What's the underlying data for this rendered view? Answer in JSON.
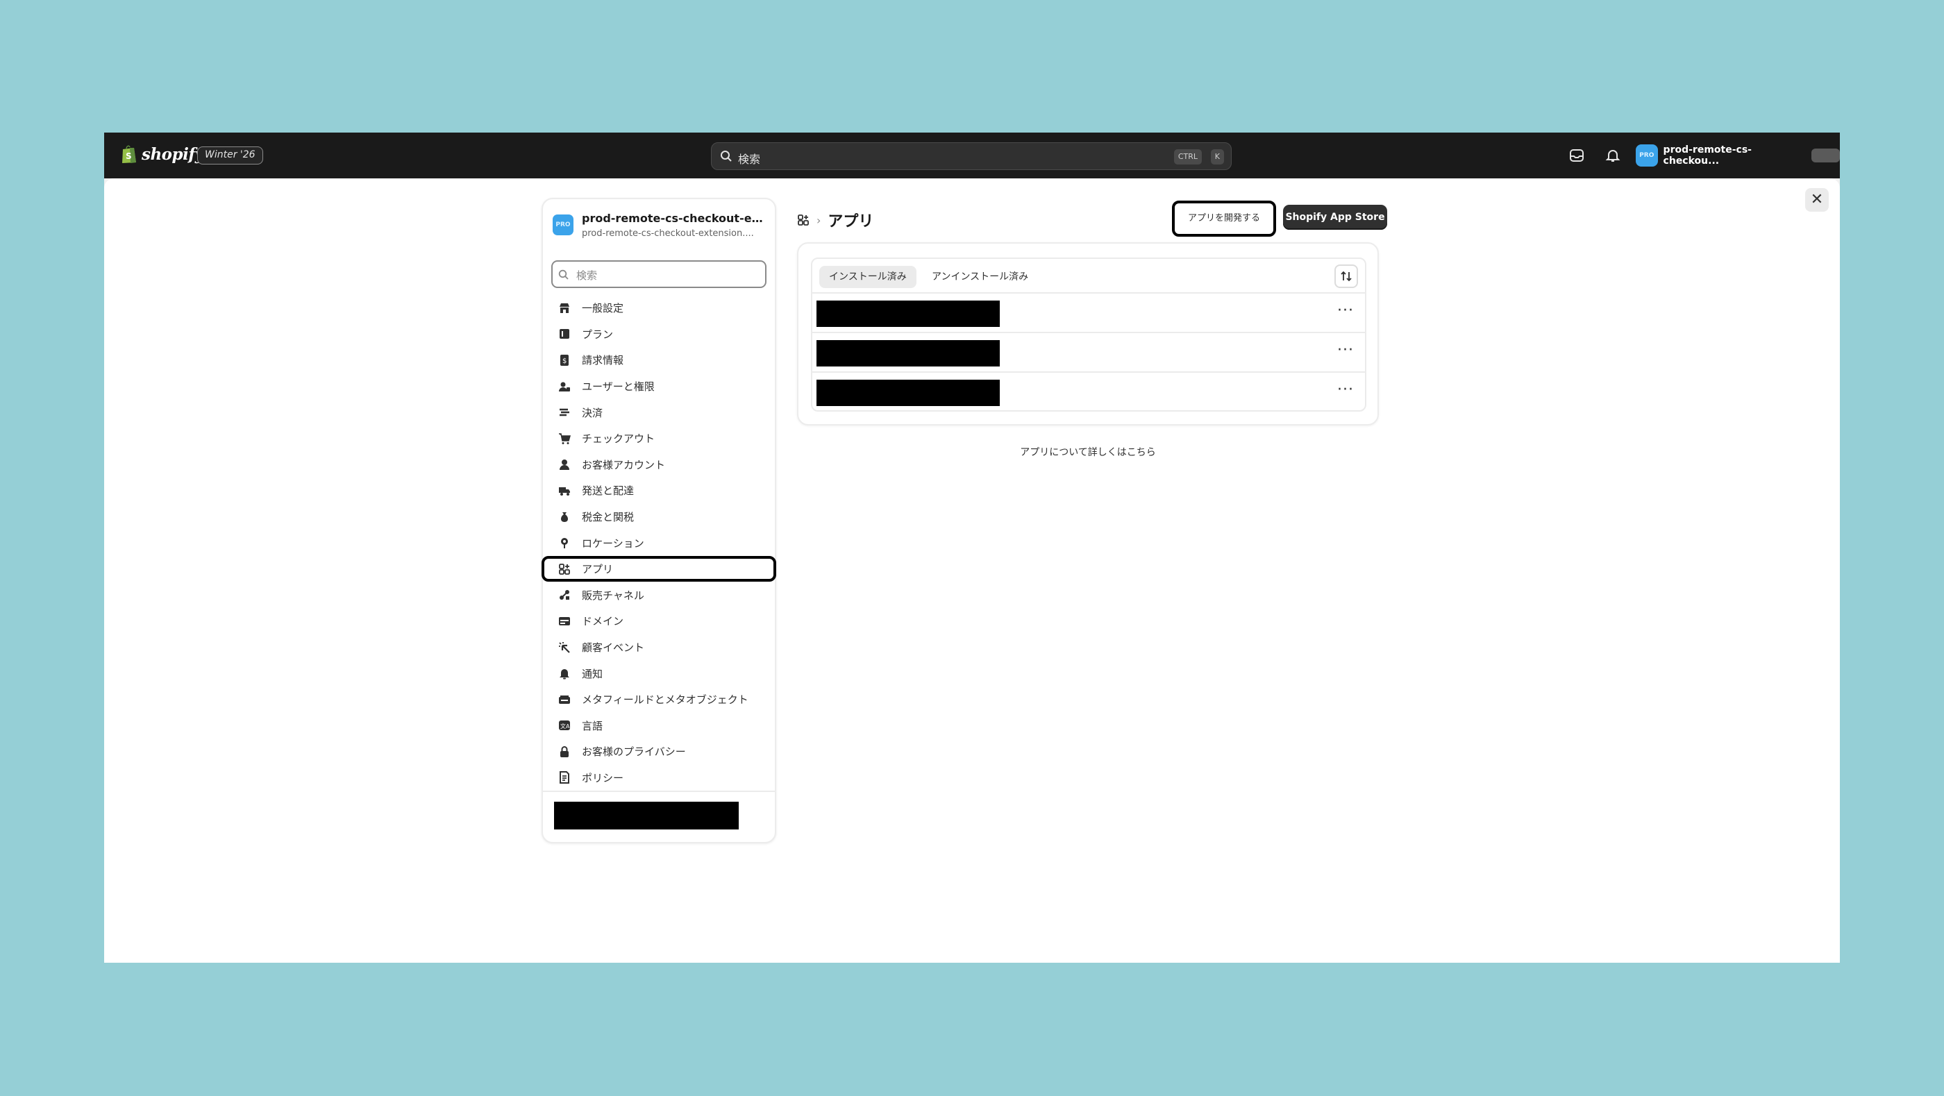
{
  "topbar": {
    "brand": "shopify",
    "edition": "Winter '26",
    "search_placeholder": "検索",
    "shortcut_ctrl": "CTRL",
    "shortcut_key": "K",
    "store_avatar": "PRO",
    "store_name": "prod-remote-cs-checkou..."
  },
  "modal": {
    "close_label": "✕"
  },
  "nav": {
    "avatar": "PRO",
    "store_name": "prod-remote-cs-checkout-exte...",
    "store_domain": "prod-remote-cs-checkout-extension....",
    "search_placeholder": "検索",
    "items": [
      {
        "label": "一般設定",
        "icon": "store-icon"
      },
      {
        "label": "プラン",
        "icon": "plan-icon"
      },
      {
        "label": "請求情報",
        "icon": "billing-icon"
      },
      {
        "label": "ユーザーと権限",
        "icon": "users-icon"
      },
      {
        "label": "決済",
        "icon": "payments-icon"
      },
      {
        "label": "チェックアウト",
        "icon": "cart-icon"
      },
      {
        "label": "お客様アカウント",
        "icon": "person-icon"
      },
      {
        "label": "発送と配達",
        "icon": "truck-icon"
      },
      {
        "label": "税金と関税",
        "icon": "tax-icon"
      },
      {
        "label": "ロケーション",
        "icon": "location-icon"
      },
      {
        "label": "アプリ",
        "icon": "apps-icon"
      },
      {
        "label": "販売チャネル",
        "icon": "channels-icon"
      },
      {
        "label": "ドメイン",
        "icon": "domain-icon"
      },
      {
        "label": "顧客イベント",
        "icon": "events-icon"
      },
      {
        "label": "通知",
        "icon": "bell-icon"
      },
      {
        "label": "メタフィールドとメタオブジェクト",
        "icon": "metafields-icon"
      },
      {
        "label": "言語",
        "icon": "language-icon"
      },
      {
        "label": "お客様のプライバシー",
        "icon": "lock-icon"
      },
      {
        "label": "ポリシー",
        "icon": "policy-icon"
      }
    ],
    "active_item": "アプリ"
  },
  "main": {
    "breadcrumb_title": "アプリ",
    "develop_button": "アプリを開発する",
    "appstore_button": "Shopify App Store",
    "tabs": [
      {
        "label": "インストール済み",
        "selected": true
      },
      {
        "label": "アンインストール済み",
        "selected": false
      }
    ],
    "rows_count_note": "",
    "row_menu": "···",
    "learn_more": "アプリについて詳しくはこちら"
  },
  "colors": {
    "background": "#95cfd6",
    "topbar": "#1a1a1a",
    "accent_avatar": "#3ba3ea",
    "primary_button": "#303030"
  }
}
